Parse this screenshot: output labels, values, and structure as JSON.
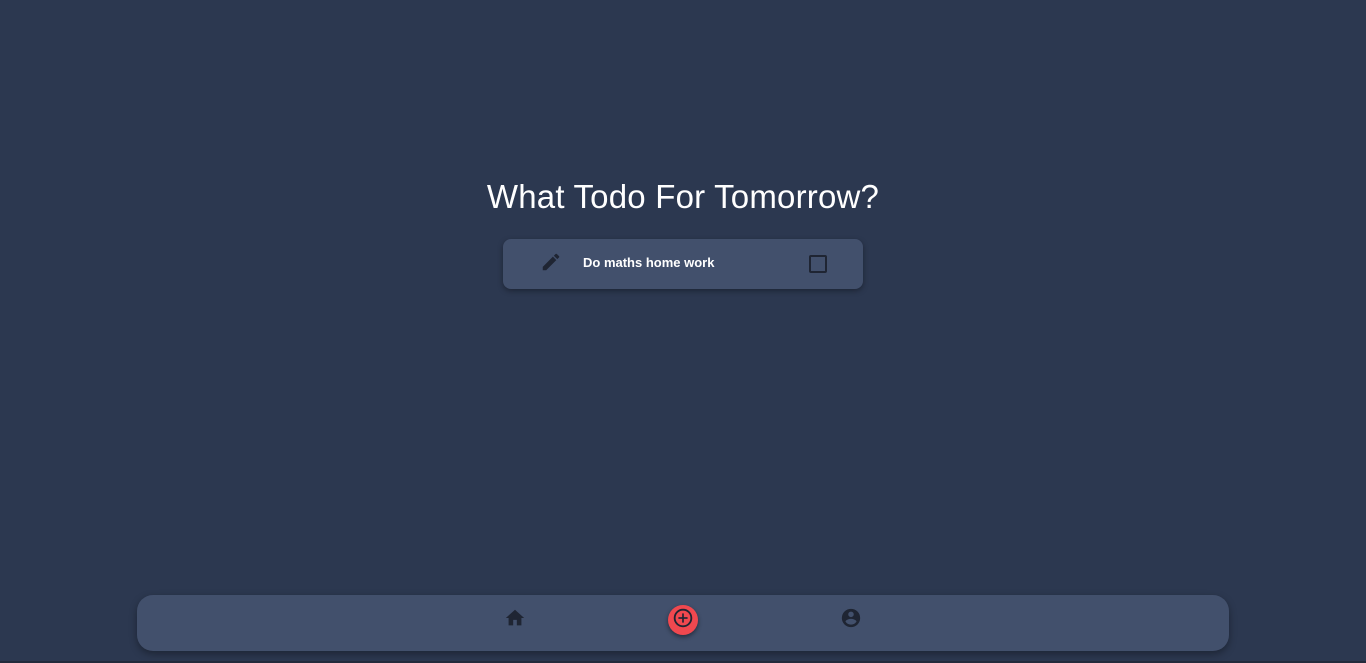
{
  "header": {
    "title": "What Todo For Tomorrow?"
  },
  "todos": [
    {
      "text": "Do maths home work",
      "done": false
    }
  ],
  "icons": {
    "edit": "pencil-icon",
    "checkbox": "checkbox-icon",
    "home": "home-icon",
    "add": "add-circle-icon",
    "profile": "account-circle-icon"
  },
  "colors": {
    "background": "#2c3850",
    "card": "#42506c",
    "accent": "#f0484f",
    "icon_dark": "#1f2533",
    "text": "#ffffff"
  }
}
